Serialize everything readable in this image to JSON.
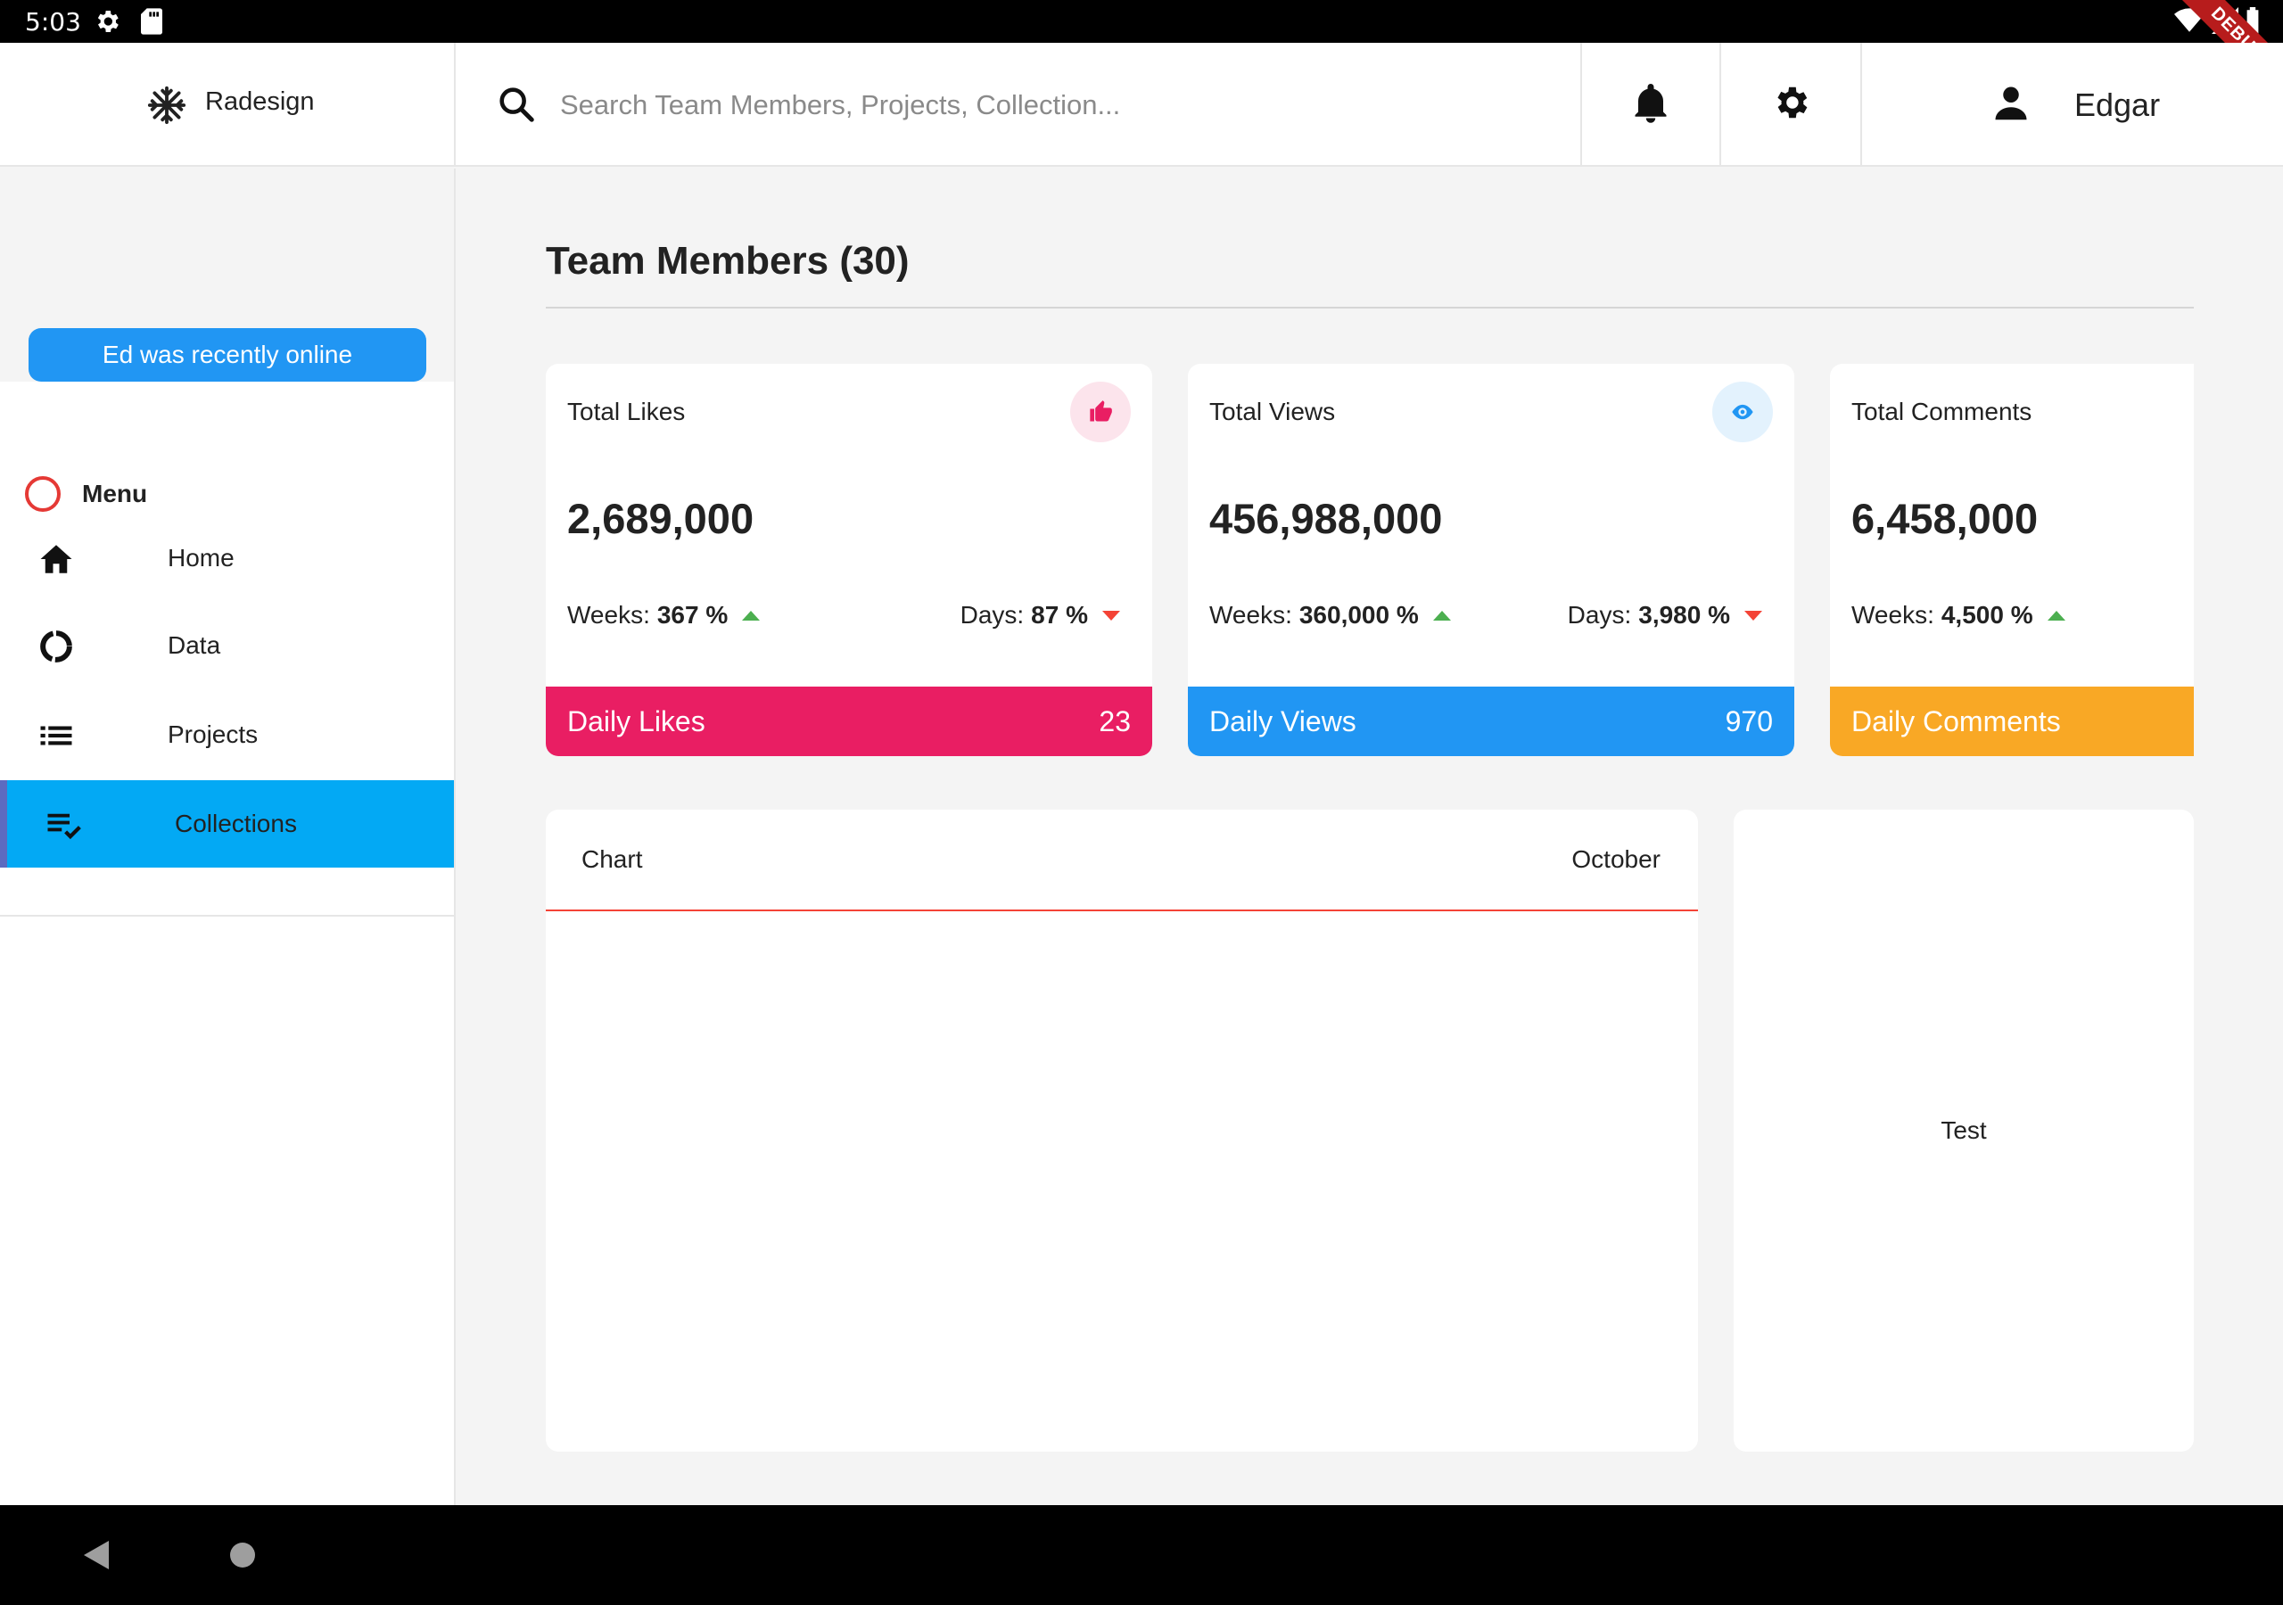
{
  "status_bar": {
    "time": "5:03",
    "debug_label": "DEBUG"
  },
  "app": {
    "brand": "Radesign"
  },
  "search": {
    "placeholder": "Search Team Members, Projects, Collection..."
  },
  "user": {
    "name": "Edgar"
  },
  "sidebar": {
    "online_badge": "Ed was recently online",
    "menu_label": "Menu",
    "items": [
      {
        "label": "Home",
        "icon": "home-icon"
      },
      {
        "label": "Data",
        "icon": "donut-chart-icon"
      },
      {
        "label": "Projects",
        "icon": "list-icon"
      },
      {
        "label": "Collections",
        "icon": "playlist-check-icon",
        "active": true
      }
    ]
  },
  "main": {
    "title": "Team Members (30)",
    "cards": [
      {
        "title": "Total Likes",
        "value": "2,689,000",
        "weeks_label": "Weeks:",
        "weeks_value": "367 %",
        "days_label": "Days:",
        "days_value": "87 %",
        "footer_label": "Daily Likes",
        "footer_value": "23",
        "icon": "thumb-up-icon",
        "color": "#e91e63",
        "badge_bg": "#fce4ec"
      },
      {
        "title": "Total Views",
        "value": "456,988,000",
        "weeks_label": "Weeks:",
        "weeks_value": "360,000 %",
        "days_label": "Days:",
        "days_value": "3,980 %",
        "footer_label": "Daily Views",
        "footer_value": "970",
        "icon": "eye-icon",
        "color": "#2196f3",
        "badge_bg": "#e3f2fd"
      },
      {
        "title": "Total Comments",
        "value": "6,458,000",
        "weeks_label": "Weeks:",
        "weeks_value": "4,500 %",
        "footer_label": "Daily Comments",
        "color": "#f9a825"
      }
    ],
    "chart_card": {
      "title": "Chart",
      "month": "October"
    },
    "test_card": {
      "label": "Test"
    }
  },
  "colors": {
    "accent_active": "#03a9f4",
    "up": "#4caf50",
    "down": "#f44336"
  }
}
